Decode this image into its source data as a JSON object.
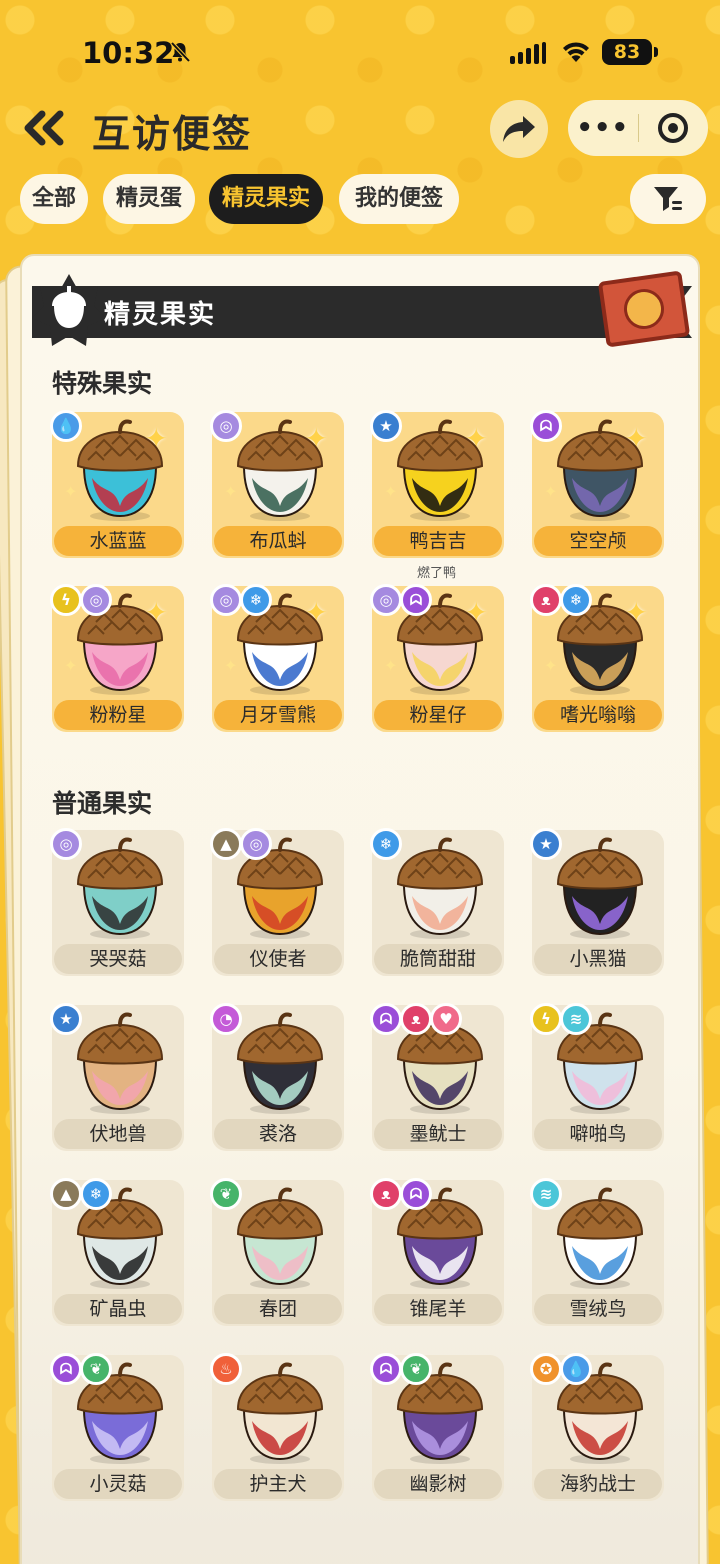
{
  "status": {
    "time": "10:32",
    "battery": "83"
  },
  "header": {
    "title": "互访便签"
  },
  "tabs": [
    {
      "label": "全部"
    },
    {
      "label": "精灵蛋"
    },
    {
      "label": "精灵果实"
    },
    {
      "label": "我的便签"
    }
  ],
  "banner": {
    "label": "精灵果实"
  },
  "sections": {
    "special": "特殊果实",
    "normal": "普通果实"
  },
  "special_items": [
    {
      "name": "水蓝蓝",
      "types": [
        "water"
      ],
      "colors": [
        "#3cc0d8",
        "#c8283a"
      ]
    },
    {
      "name": "布瓜蚪",
      "types": [
        "wind"
      ],
      "colors": [
        "#f4f2ec",
        "#2d5a4a"
      ]
    },
    {
      "name": "鸭吉吉",
      "types": [
        "normal"
      ],
      "colors": [
        "#f6d21e",
        "#111111"
      ],
      "sub": "燃了鸭"
    },
    {
      "name": "空空颅",
      "types": [
        "ghost"
      ],
      "colors": [
        "#3f5565",
        "#7c6bb8"
      ]
    },
    {
      "name": "粉粉星",
      "types": [
        "electric",
        "wind"
      ],
      "colors": [
        "#f6a6c8",
        "#e86aa8"
      ]
    },
    {
      "name": "月牙雪熊",
      "types": [
        "wind",
        "ice"
      ],
      "colors": [
        "#ffffff",
        "#2c63c8"
      ]
    },
    {
      "name": "粉星仔",
      "types": [
        "wind",
        "ghost"
      ],
      "colors": [
        "#f6d7d0",
        "#f4d45a"
      ]
    },
    {
      "name": "嗜光嗡嗡",
      "types": [
        "demon",
        "ice"
      ],
      "colors": [
        "#2a2a2a",
        "#e6b460"
      ]
    }
  ],
  "normal_items": [
    {
      "name": "哭哭菇",
      "types": [
        "wind"
      ],
      "colors": [
        "#7fcfc8",
        "#2c2c2c"
      ]
    },
    {
      "name": "仪使者",
      "types": [
        "ground",
        "wind"
      ],
      "colors": [
        "#e8a32c",
        "#d24026"
      ]
    },
    {
      "name": "脆筒甜甜",
      "types": [
        "ice"
      ],
      "colors": [
        "#f2efe8",
        "#f2a98e"
      ]
    },
    {
      "name": "小黑猫",
      "types": [
        "normal"
      ],
      "colors": [
        "#222222",
        "#9a6ee8"
      ]
    },
    {
      "name": "伏地兽",
      "types": [
        "normal"
      ],
      "colors": [
        "#e3b382",
        "#f3a3b3"
      ]
    },
    {
      "name": "裘洛",
      "types": [
        "bug"
      ],
      "colors": [
        "#2f2f38",
        "#b8e8d8"
      ]
    },
    {
      "name": "墨鱿士",
      "types": [
        "ghost",
        "demon",
        "love"
      ],
      "colors": [
        "#e6e0c0",
        "#3a2a5a"
      ]
    },
    {
      "name": "噼啪鸟",
      "types": [
        "electric",
        "flying"
      ],
      "colors": [
        "#cfe2ec",
        "#f3b8d8"
      ]
    },
    {
      "name": "矿晶虫",
      "types": [
        "ground",
        "ice"
      ],
      "colors": [
        "#dfe8e6",
        "#1c1c1c"
      ]
    },
    {
      "name": "春团",
      "types": [
        "grass"
      ],
      "colors": [
        "#c6e6d2",
        "#f4b6c6"
      ]
    },
    {
      "name": "锥尾羊",
      "types": [
        "demon",
        "ghost"
      ],
      "colors": [
        "#6a4a9a",
        "#ffffff"
      ]
    },
    {
      "name": "雪绒鸟",
      "types": [
        "flying"
      ],
      "colors": [
        "#ffffff",
        "#3c8ed8"
      ]
    },
    {
      "name": "小灵菇",
      "types": [
        "ghost",
        "grass"
      ],
      "colors": [
        "#7a6cd8",
        "#d0c8f8"
      ]
    },
    {
      "name": "护主犬",
      "types": [
        "fire"
      ],
      "colors": [
        "#f2e6d2",
        "#c42e2e"
      ]
    },
    {
      "name": "幽影树",
      "types": [
        "ghost",
        "grass"
      ],
      "colors": [
        "#6a4a9a",
        "#b59ae8"
      ]
    },
    {
      "name": "海豹战士",
      "types": [
        "fighting",
        "water"
      ],
      "colors": [
        "#f4e6d6",
        "#c4322c"
      ]
    }
  ],
  "type_colors": {
    "water": "#4a9be8",
    "wind": "#a58ae0",
    "normal": "#3a7fd0",
    "ghost": "#9a4ed8",
    "electric": "#e8c21e",
    "ice": "#3f9ae8",
    "demon": "#e0406a",
    "ground": "#8a7a5a",
    "bug": "#c45ad8",
    "love": "#f06a8a",
    "flying": "#4cc6d8",
    "grass": "#46b46a",
    "fire": "#f0603a",
    "fighting": "#f0922c"
  },
  "type_glyphs": {
    "water": "💧",
    "wind": "◎",
    "normal": "★",
    "ghost": "ᗣ",
    "electric": "ϟ",
    "ice": "❄",
    "demon": "ᴥ",
    "ground": "▲",
    "bug": "◔",
    "love": "♥",
    "flying": "≋",
    "grass": "❦",
    "fire": "♨",
    "fighting": "✪"
  }
}
